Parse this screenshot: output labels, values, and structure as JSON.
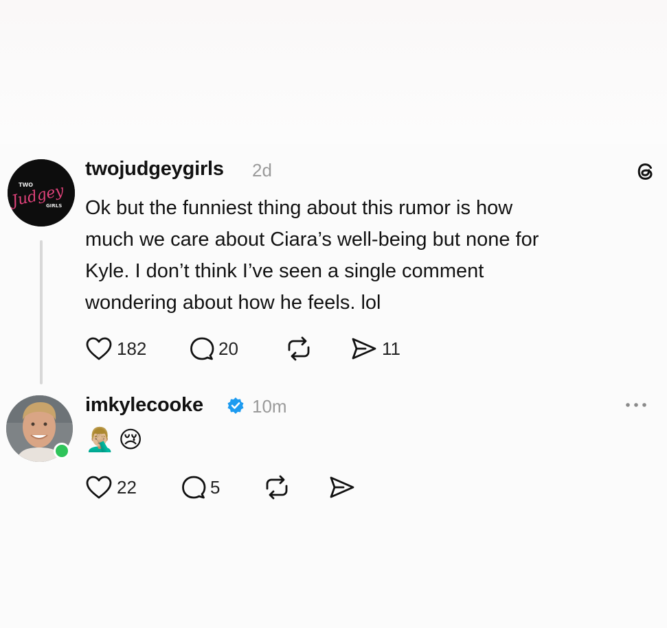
{
  "posts": [
    {
      "username": "twojudgeygirls",
      "time": "2d",
      "avatar_logo": {
        "top": "TWO",
        "script": "Judgey",
        "bottom": "GIRLS"
      },
      "text_lines": [
        "Ok but the funniest thing about this rumor is how",
        "much we care about Ciara’s well-being but none for",
        "Kyle. I don’t think I’ve seen a single comment",
        "wondering about how he feels. lol"
      ],
      "likes": "182",
      "comments": "20",
      "shares": "11",
      "platform_icon": "threads-icon"
    },
    {
      "username": "imkylecooke",
      "verified": true,
      "time": "10m",
      "emojis": [
        "🤦🏼‍♂️",
        "😢"
      ],
      "likes": "22",
      "comments": "5"
    }
  ],
  "colors": {
    "verified": "#1d9bf0",
    "online": "#2fc45a",
    "logo_pink": "#e0427a",
    "muted_text": "#9a9a9a"
  }
}
